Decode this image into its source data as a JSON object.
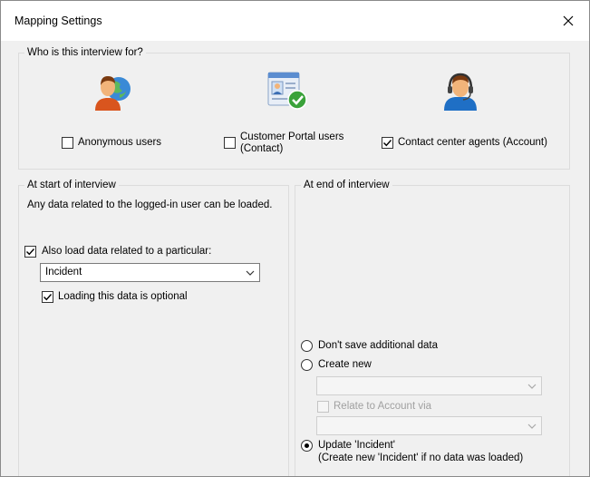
{
  "window": {
    "title": "Mapping Settings",
    "close_label": "✕"
  },
  "who": {
    "legend": "Who is this interview for?",
    "options": [
      {
        "label": "Anonymous users",
        "checked": false
      },
      {
        "label_line1": "Customer Portal users",
        "label_line2": "(Contact)",
        "checked": false
      },
      {
        "label": "Contact center agents (Account)",
        "checked": true
      }
    ]
  },
  "start": {
    "legend": "At start of interview",
    "description": "Any data related to the logged-in user can be loaded.",
    "also_load_label": "Also load data related to a particular:",
    "also_load_checked": true,
    "entity_value": "Incident",
    "optional_label": "Loading this data is optional",
    "optional_checked": true
  },
  "end": {
    "legend": "At end of interview",
    "dont_save_label": "Don't save additional data",
    "create_new_label": "Create new",
    "create_new_value": "",
    "relate_label": "Relate to Account via",
    "relate_value": "",
    "update_label_line1": "Update 'Incident'",
    "update_label_line2": "(Create new 'Incident' if no data was loaded)",
    "selected": "update"
  },
  "colors": {
    "accent": "#1a1a1a",
    "green_check": "#2ea043",
    "disabled_text": "#a0a0a0"
  }
}
